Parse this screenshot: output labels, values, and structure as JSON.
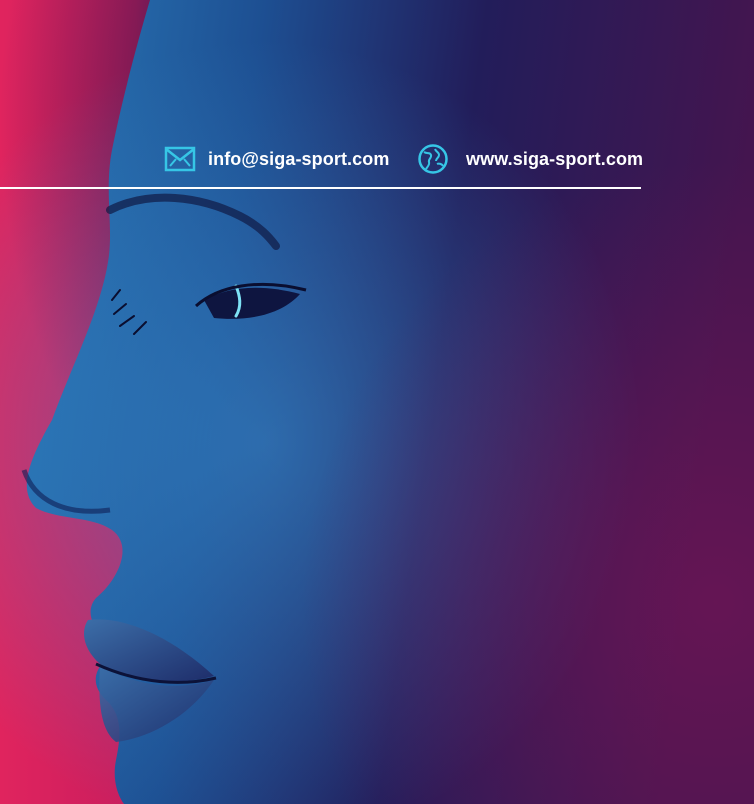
{
  "contact": {
    "email": {
      "icon": "envelope-icon",
      "text": "info@siga-sport.com"
    },
    "website": {
      "icon": "globe-icon",
      "text": "www.siga-sport.com"
    }
  },
  "colors": {
    "icon_accent": "#36c6e6",
    "text": "#ffffff",
    "background_left": "#e0245e",
    "background_right": "#2a0f3f"
  }
}
